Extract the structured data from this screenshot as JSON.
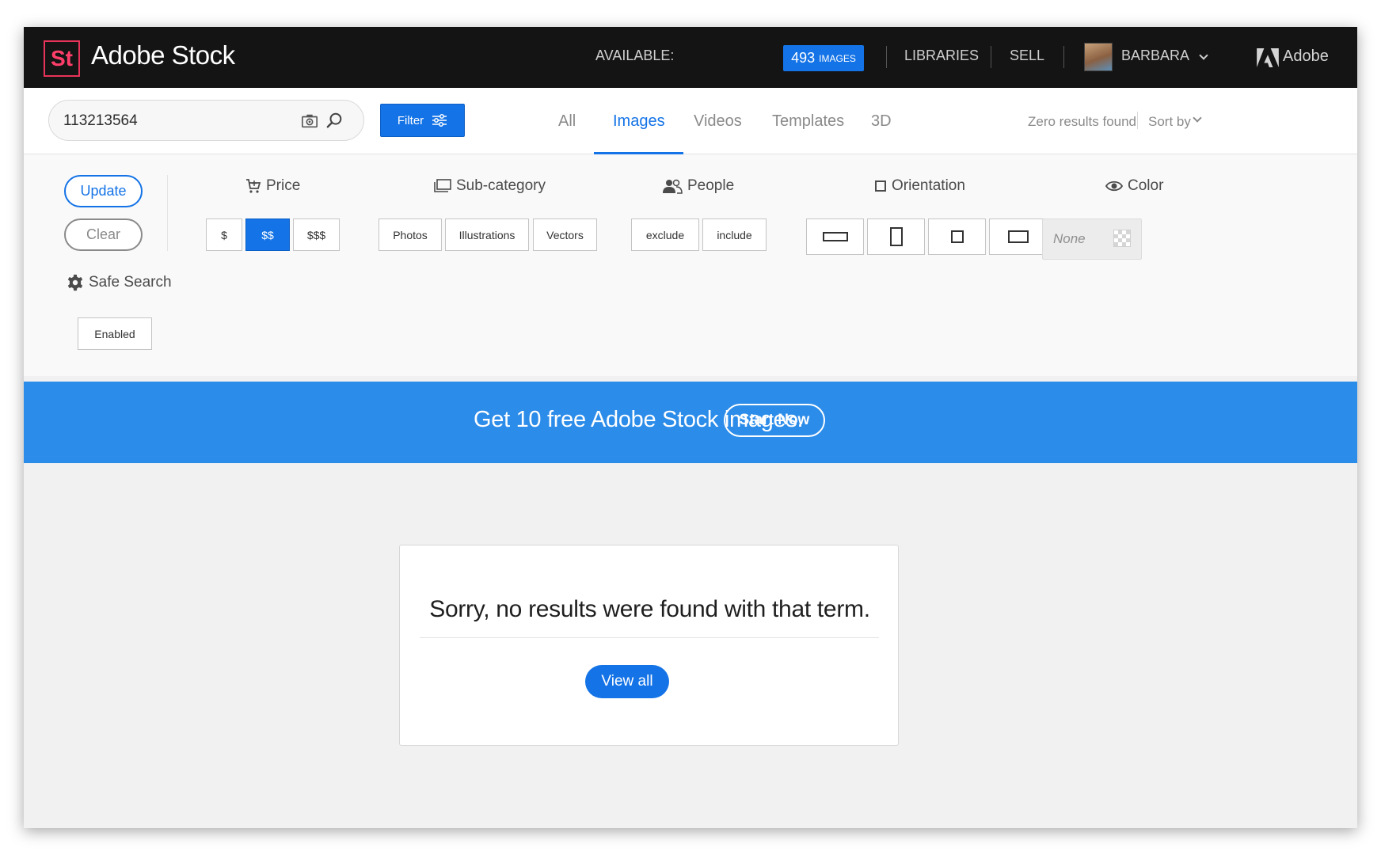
{
  "header": {
    "logo_text": "St",
    "brand": "Adobe Stock",
    "available_label": "AVAILABLE:",
    "available_count": "493",
    "available_unit": "IMAGES",
    "libraries": "LIBRARIES",
    "sell": "SELL",
    "user_name": "BARBARA",
    "adobe_label": "Adobe"
  },
  "search": {
    "value": "113213564",
    "filter_label": "Filter"
  },
  "tabs": [
    {
      "label": "All",
      "active": false
    },
    {
      "label": "Images",
      "active": true
    },
    {
      "label": "Videos",
      "active": false
    },
    {
      "label": "Templates",
      "active": false
    },
    {
      "label": "3D",
      "active": false
    }
  ],
  "results": {
    "status": "Zero results found",
    "sort_label": "Sort by"
  },
  "filters": {
    "update_label": "Update",
    "clear_label": "Clear",
    "price": {
      "title": "Price",
      "options": [
        "$",
        "$$",
        "$$$"
      ],
      "selected": "$$"
    },
    "subcategory": {
      "title": "Sub-category",
      "options": [
        "Photos",
        "Illustrations",
        "Vectors"
      ]
    },
    "people": {
      "title": "People",
      "options": [
        "exclude",
        "include"
      ]
    },
    "orientation": {
      "title": "Orientation",
      "options": [
        "horizontal",
        "vertical",
        "square",
        "panoramic"
      ]
    },
    "color": {
      "title": "Color",
      "value": "None"
    },
    "safe_search": {
      "title": "Safe Search",
      "value": "Enabled"
    }
  },
  "banner": {
    "text": "Get 10 free Adobe Stock images.",
    "button": "Start Now"
  },
  "empty_state": {
    "message": "Sorry, no results were found with that term.",
    "button": "View all"
  },
  "colors": {
    "accent": "#1473e6",
    "banner": "#2c8ce9",
    "topbar": "#141414",
    "brand_red": "#ff3f6a"
  }
}
